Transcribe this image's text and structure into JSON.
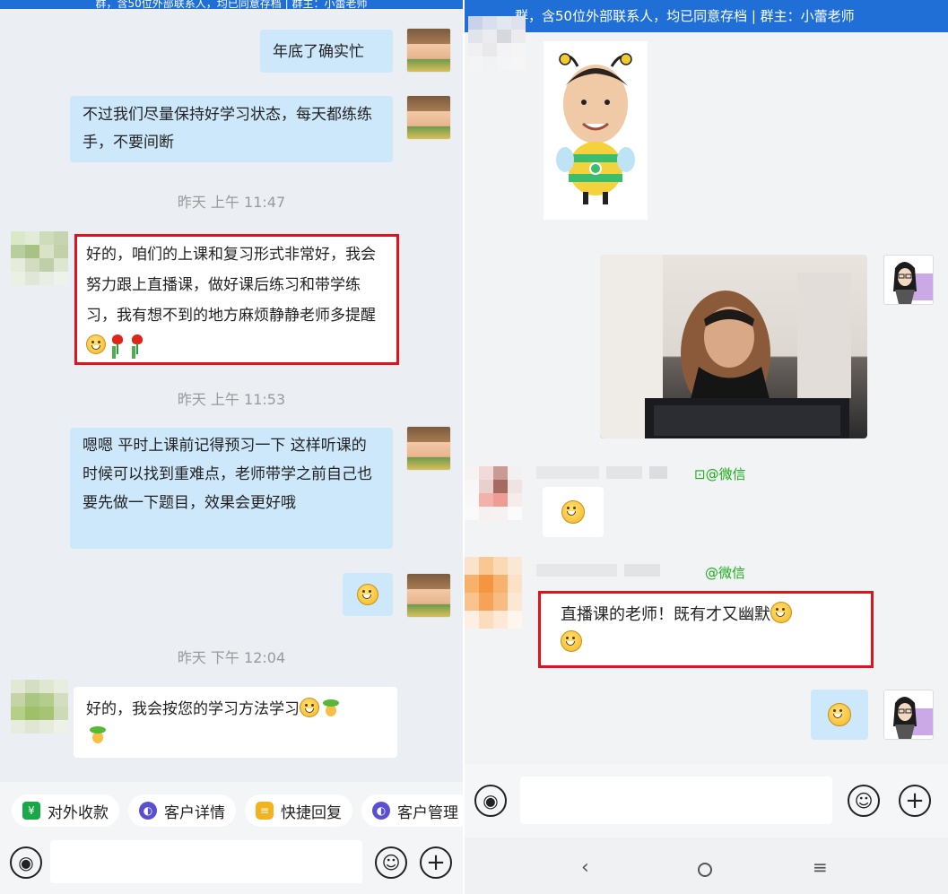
{
  "left": {
    "top_banner": "群，含50位外部联系人，均已同意存档 | 群主：小蕾老师",
    "messages": [
      {
        "text": "年底了确实忙"
      },
      {
        "text": "不过我们尽量保持好学习状态，每天都练练手，不要间断"
      },
      {
        "time": "昨天 上午 11:47"
      },
      {
        "text": "好的，咱们的上课和复习形式非常好，我会努力跟上直播课，做好课后练习和带学练习，我有想不到的地方麻烦静静老师多提醒"
      },
      {
        "time": "昨天 上午 11:53"
      },
      {
        "text": "嗯嗯 平时上课前记得预习一下 这样听课的时候可以找到重难点，老师带学之前自己也要先做一下题目，效果会更好哦"
      },
      {
        "time": "昨天 下午 12:04"
      },
      {
        "text": "好的，我会按您的学习方法学习"
      }
    ],
    "quick_actions": [
      "对外收款",
      "客户详情",
      "快捷回复",
      "客户管理"
    ]
  },
  "right": {
    "top_banner": "群，含50位外部联系人，均已同意存档 | 群主：小蕾老师",
    "sender_tag_1": "@微信",
    "sender_tag_2": "@微信",
    "highlight_message": "直播课的老师！既有才又幽默"
  },
  "colors": {
    "brand_blue": "#1f6fd6",
    "highlight_red": "#e0121b",
    "bubble_blue": "#cde7fb",
    "wechat_green": "#1aad19"
  },
  "icons": {
    "voice": "voice-icon",
    "emoji": "emoji-icon",
    "plus": "plus-icon",
    "back": "back-icon",
    "home": "home-icon",
    "menu": "menu-icon"
  }
}
